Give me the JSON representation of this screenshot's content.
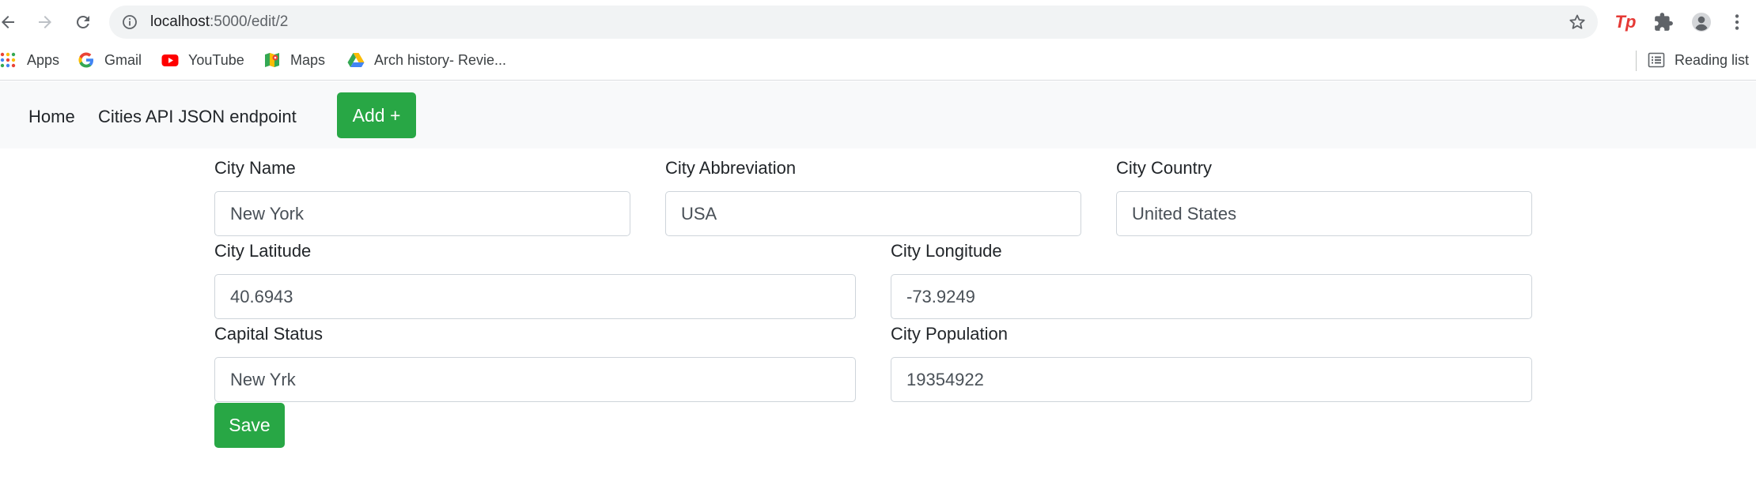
{
  "browser": {
    "url_host": "localhost",
    "url_path": ":5000/edit/2",
    "bookmarks": [
      {
        "label": "Apps",
        "icon": "apps-grid-icon"
      },
      {
        "label": "Gmail",
        "icon": "google-icon"
      },
      {
        "label": "YouTube",
        "icon": "youtube-icon"
      },
      {
        "label": "Maps",
        "icon": "maps-icon"
      },
      {
        "label": "Arch history- Revie...",
        "icon": "google-drive-icon"
      }
    ],
    "reading_list": "Reading list",
    "extension_tp_label": "Tp"
  },
  "navbar": {
    "home": "Home",
    "cities_api": "Cities API JSON endpoint",
    "add": "Add +"
  },
  "form": {
    "city_name": {
      "label": "City Name",
      "value": "New York"
    },
    "city_abbreviation": {
      "label": "City Abbreviation",
      "value": "USA"
    },
    "city_country": {
      "label": "City Country",
      "value": "United States"
    },
    "city_latitude": {
      "label": "City Latitude",
      "value": "40.6943"
    },
    "city_longitude": {
      "label": "City Longitude",
      "value": "-73.9249"
    },
    "capital_status": {
      "label": "Capital Status",
      "value": "New Yrk"
    },
    "city_population": {
      "label": "City Population",
      "value": "19354922"
    },
    "save": "Save"
  },
  "colors": {
    "success_green": "#28a745",
    "navbar_bg": "#f8f9fa",
    "omnibox_bg": "#f1f3f4"
  }
}
